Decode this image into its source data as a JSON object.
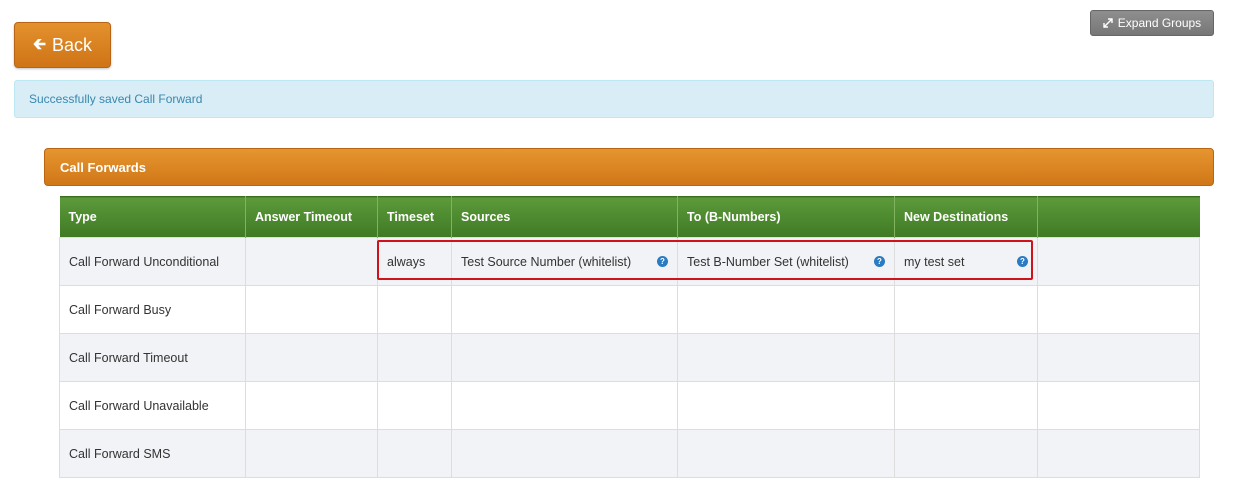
{
  "toolbar": {
    "back_label": "Back",
    "expand_label": "Expand Groups"
  },
  "alert": {
    "message": "Successfully saved Call Forward"
  },
  "panel": {
    "title": "Call Forwards"
  },
  "table": {
    "headers": [
      "Type",
      "Answer Timeout",
      "Timeset",
      "Sources",
      "To (B-Numbers)",
      "New Destinations",
      ""
    ],
    "rows": [
      {
        "type": "Call Forward Unconditional",
        "answer_timeout": "",
        "timeset": "always",
        "sources": "Test Source Number (whitelist)",
        "b_numbers": "Test B-Number Set (whitelist)",
        "destinations": "my test set"
      },
      {
        "type": "Call Forward Busy",
        "answer_timeout": "",
        "timeset": "",
        "sources": "",
        "b_numbers": "",
        "destinations": ""
      },
      {
        "type": "Call Forward Timeout",
        "answer_timeout": "",
        "timeset": "",
        "sources": "",
        "b_numbers": "",
        "destinations": ""
      },
      {
        "type": "Call Forward Unavailable",
        "answer_timeout": "",
        "timeset": "",
        "sources": "",
        "b_numbers": "",
        "destinations": ""
      },
      {
        "type": "Call Forward SMS",
        "answer_timeout": "",
        "timeset": "",
        "sources": "",
        "b_numbers": "",
        "destinations": ""
      }
    ]
  },
  "icons": {
    "back": "arrow-left-icon",
    "expand": "expand-icon",
    "info": "question-circle-icon"
  },
  "colors": {
    "accent_orange": "#d9822b",
    "header_green": "#4a8a2e",
    "alert_blue": "#d9edf7",
    "highlight_red": "#d0131b"
  }
}
